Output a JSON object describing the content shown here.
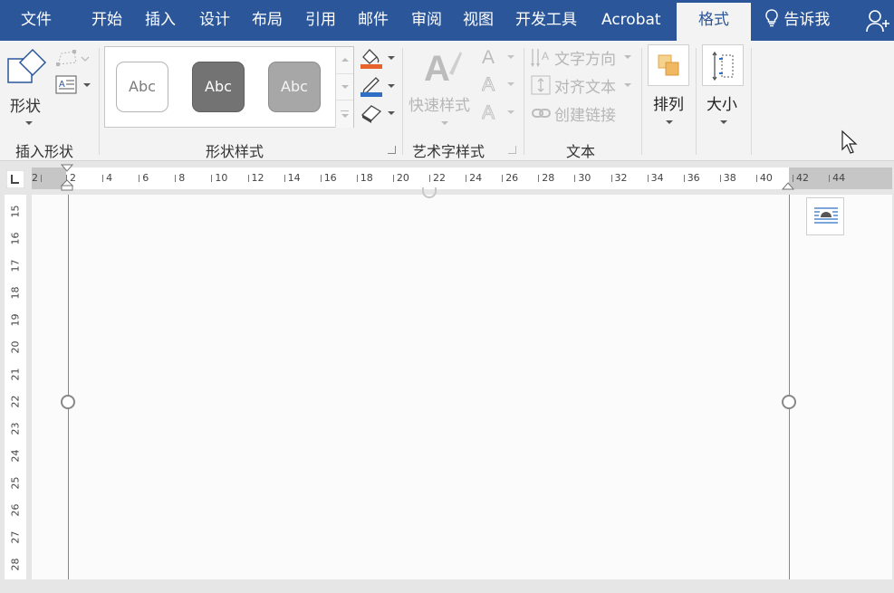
{
  "tabs": {
    "file": "文件",
    "home": "开始",
    "insert": "插入",
    "design": "设计",
    "layout": "布局",
    "references": "引用",
    "mailings": "邮件",
    "review": "审阅",
    "view": "视图",
    "developer": "开发工具",
    "acrobat": "Acrobat",
    "format": "格式",
    "tell_me": "告诉我"
  },
  "ribbon": {
    "insert_shapes": {
      "shape_label": "形状",
      "group_label": "插入形状"
    },
    "shape_styles": {
      "presets": [
        "Abc",
        "Abc",
        "Abc"
      ],
      "group_label": "形状样式"
    },
    "wordart_styles": {
      "quick_styles_label": "快速样式",
      "group_label": "艺术字样式"
    },
    "text": {
      "text_direction": "文字方向",
      "align_text": "对齐文本",
      "create_link": "创建链接",
      "group_label": "文本"
    },
    "arrange_label": "排列",
    "size_label": "大小"
  },
  "ruler": {
    "horizontal": [
      "2",
      "2",
      "4",
      "6",
      "8",
      "10",
      "12",
      "14",
      "16",
      "18",
      "20",
      "22",
      "24",
      "26",
      "28",
      "30",
      "32",
      "34",
      "36",
      "38",
      "40",
      "42",
      "44"
    ],
    "vertical": [
      "15",
      "16",
      "17",
      "18",
      "19",
      "20",
      "21",
      "22",
      "23",
      "24",
      "25",
      "26",
      "27",
      "28"
    ]
  },
  "colors": {
    "accent": "#2b579a",
    "ribbon_bg": "#f3f3f3",
    "fill_swatch": "#e8632b",
    "line_swatch": "#2f6fc4"
  }
}
